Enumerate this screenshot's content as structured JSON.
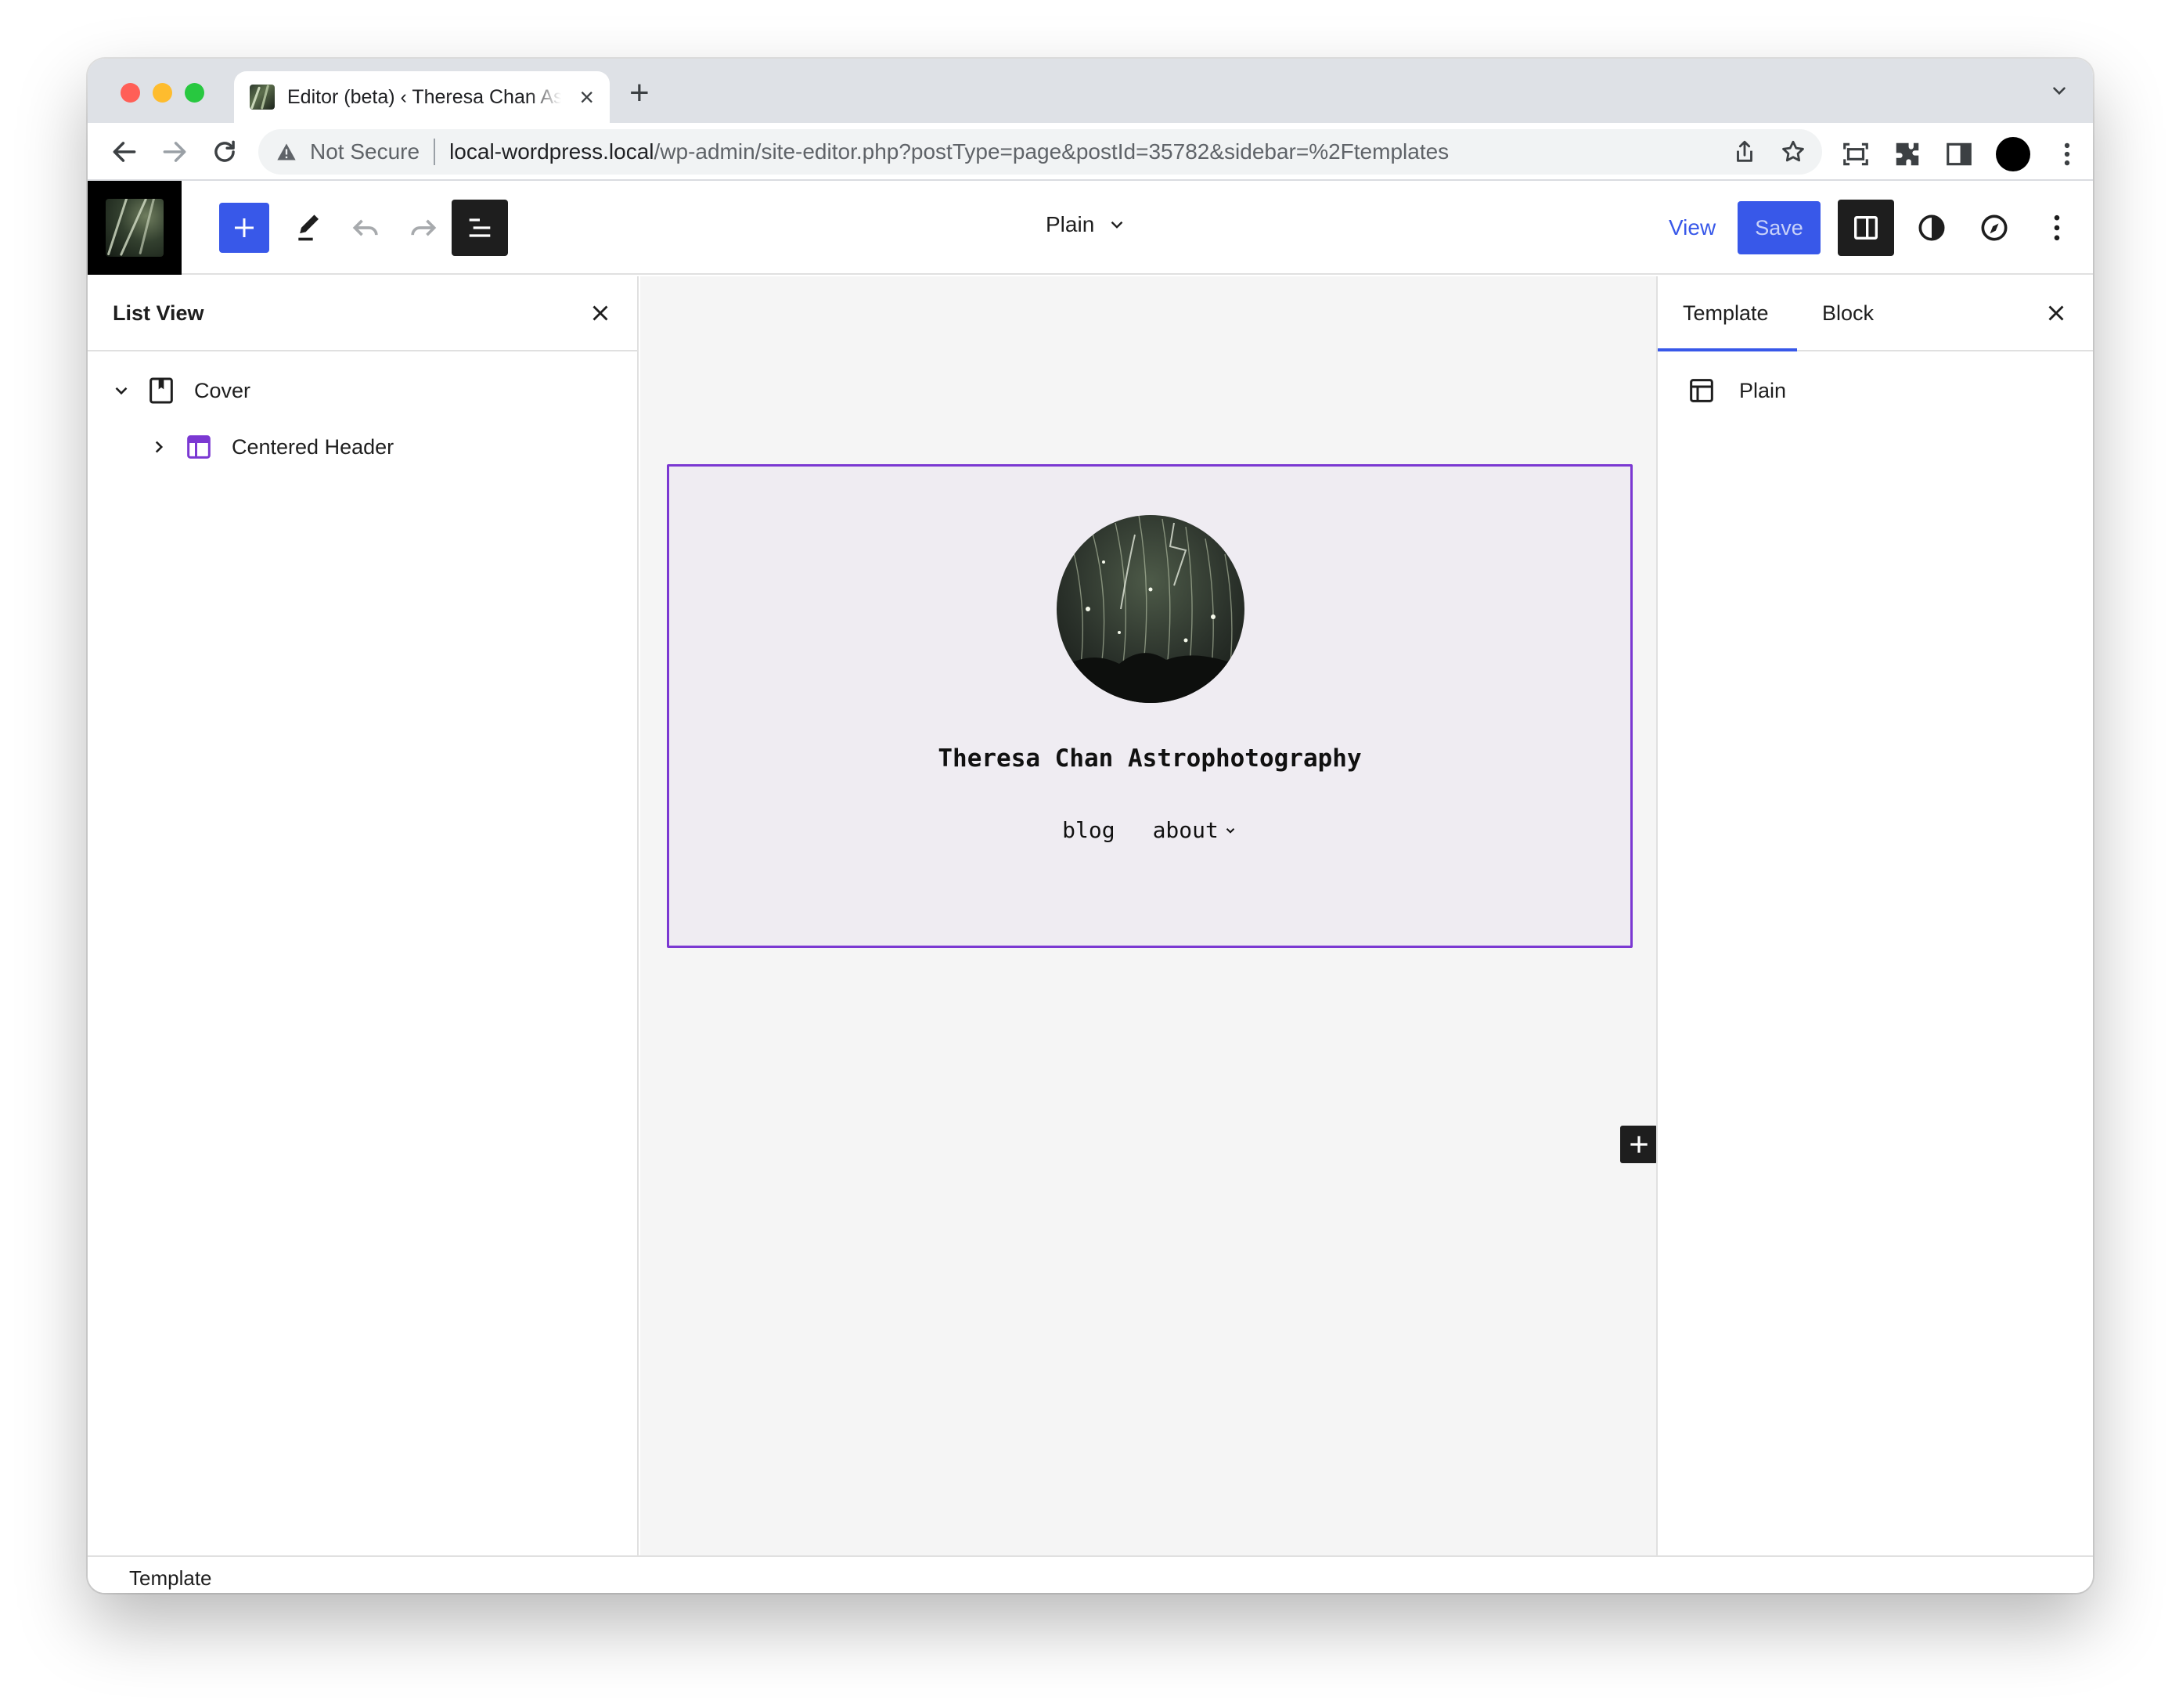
{
  "browser": {
    "tab_title": "Editor (beta) ‹ Theresa Chan Astrophotography",
    "security_label": "Not Secure",
    "url_host": "local-wordpress.local",
    "url_path": "/wp-admin/site-editor.php?postType=page&postId=35782&sidebar=%2Ftemplates"
  },
  "header": {
    "document_title": "Plain",
    "view_label": "View",
    "save_label": "Save"
  },
  "list_view": {
    "title": "List View",
    "items": [
      {
        "label": "Cover",
        "expanded": true,
        "icon": "cover-icon"
      },
      {
        "label": "Centered Header",
        "expanded": false,
        "icon": "template-part-icon"
      }
    ]
  },
  "canvas": {
    "site_title": "Theresa Chan Astrophotography",
    "nav": [
      "blog",
      "about"
    ]
  },
  "sidebar": {
    "tabs": [
      "Template",
      "Block"
    ],
    "active_tab": "Template",
    "template_name": "Plain"
  },
  "footer": {
    "breadcrumb": "Template"
  },
  "colors": {
    "accent": "#3858e9",
    "block_selection": "#7b38d2",
    "template_part": "#7b38d2",
    "cover_background": "#efecf2"
  }
}
